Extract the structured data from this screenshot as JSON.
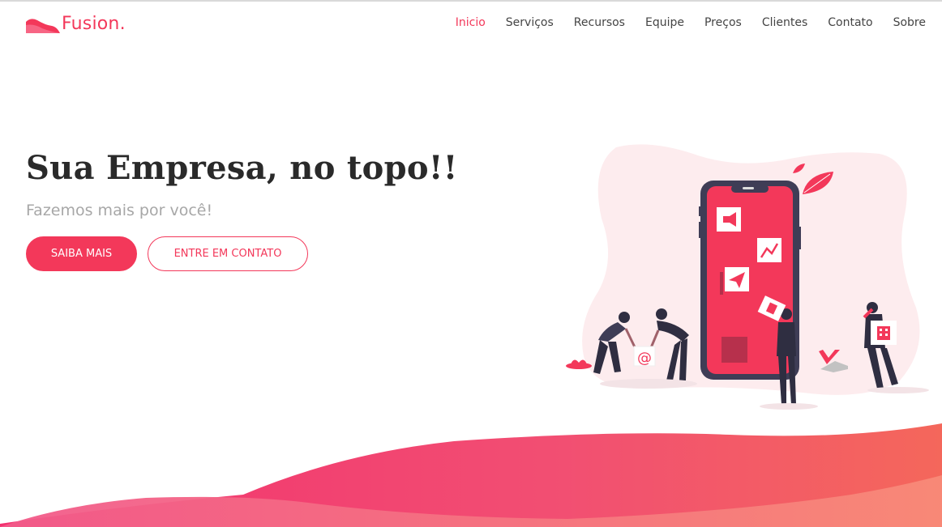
{
  "brand": {
    "name": "Fusion."
  },
  "nav": {
    "items": [
      {
        "label": "Inicio",
        "active": true
      },
      {
        "label": "Serviços"
      },
      {
        "label": "Recursos"
      },
      {
        "label": "Equipe"
      },
      {
        "label": "Preços"
      },
      {
        "label": "Clientes"
      },
      {
        "label": "Contato"
      },
      {
        "label": "Sobre"
      }
    ]
  },
  "hero": {
    "title": "Sua Empresa, no topo!!",
    "subtitle": "Fazemos mais por você!",
    "primary_button": "SAIBA MAIS",
    "secondary_button": "ENTRE EM CONTATO"
  },
  "colors": {
    "accent": "#f3385a",
    "wave_start": "#f3316f",
    "wave_end": "#f4675b",
    "blob": "#fdecee",
    "phone_frame": "#3f3d56"
  },
  "icons": [
    "megaphone-icon",
    "chart-icon",
    "paper-plane-icon",
    "at-sign-icon",
    "building-icon",
    "leaf-icon"
  ]
}
